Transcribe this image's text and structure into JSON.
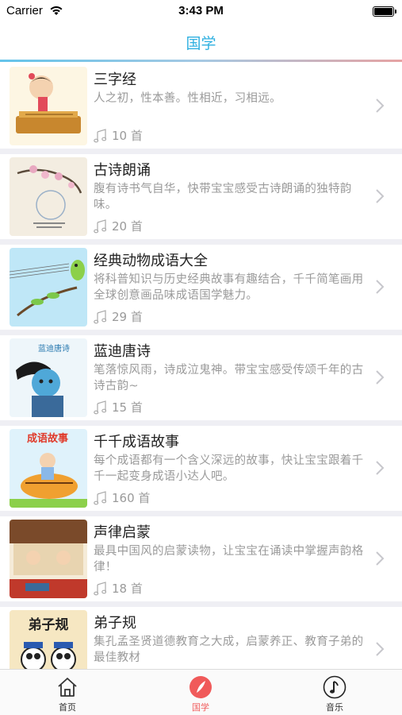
{
  "status": {
    "carrier": "Carrier",
    "time": "3:43 PM"
  },
  "nav": {
    "title": "国学"
  },
  "items": [
    {
      "title": "三字经",
      "desc": "人之初，性本善。性相近，习相远。",
      "count": "10 首"
    },
    {
      "title": "古诗朗诵",
      "desc": "腹有诗书气自华，快带宝宝感受古诗朗诵的独特韵味。",
      "count": "20 首"
    },
    {
      "title": "经典动物成语大全",
      "desc": "将科普知识与历史经典故事有趣结合，千千简笔画用全球创意画品味成语国学魅力。",
      "count": "29 首"
    },
    {
      "title": "蓝迪唐诗",
      "desc": "笔落惊风雨，诗成泣鬼神。带宝宝感受传颂千年的古诗古韵~",
      "count": "15 首",
      "thumb_text": "蓝迪唐诗"
    },
    {
      "title": "千千成语故事",
      "desc": "每个成语都有一个含义深远的故事，快让宝宝跟着千千一起变身成语小达人吧。",
      "count": "160 首",
      "thumb_text": "成语故事"
    },
    {
      "title": "声律启蒙",
      "desc": "最具中国风的启蒙读物，让宝宝在诵读中掌握声韵格律！",
      "count": "18 首"
    },
    {
      "title": "弟子规",
      "desc": "集孔孟圣贤道德教育之大成，启蒙养正、教育子弟的最佳教材",
      "count": "",
      "thumb_text": "弟子规"
    }
  ],
  "tabs": [
    {
      "label": "首页",
      "icon": "home-icon"
    },
    {
      "label": "国学",
      "icon": "brush-icon"
    },
    {
      "label": "音乐",
      "icon": "music-note-icon"
    }
  ],
  "colors": {
    "accent": "#2fb0e0",
    "active_tab": "#f06060"
  }
}
